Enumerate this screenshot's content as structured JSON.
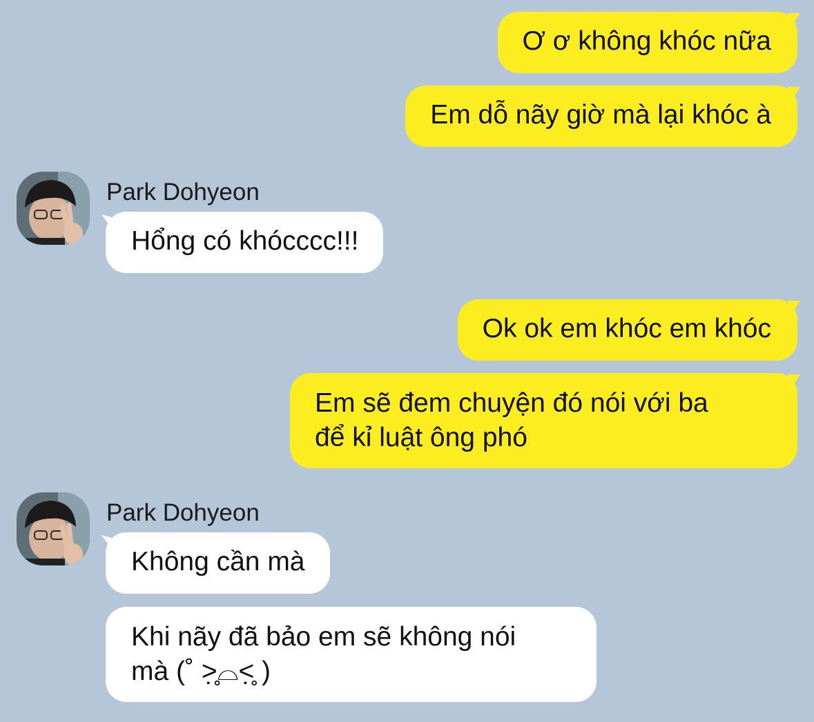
{
  "messages": [
    {
      "type": "outgoing",
      "text": "Ơ ơ không khóc nữa"
    },
    {
      "type": "outgoing",
      "text": "Em dỗ nãy giờ mà lại khóc à"
    },
    {
      "type": "incoming",
      "sender": "Park Dohyeon",
      "text": "Hổng có khócccc!!!"
    },
    {
      "type": "outgoing",
      "text": "Ok ok em khóc em khóc"
    },
    {
      "type": "outgoing",
      "line1": "Em sẽ đem chuyện đó nói với ba",
      "line2": "để kỉ luật ông phó"
    },
    {
      "type": "incoming",
      "sender": "Park Dohyeon",
      "text": "Không cần mà"
    },
    {
      "type": "incoming",
      "line1": "Khi nãy đã bảo em sẽ không nói",
      "line2": "mà (˚ ˃̣̣̥⌓˂̣̣̥ )"
    }
  ],
  "colors": {
    "background": "#b5c6d9",
    "outgoing_bubble": "#fbed20",
    "incoming_bubble": "#ffffff"
  },
  "icons": {
    "avatar": "profile-photo-avatar"
  }
}
